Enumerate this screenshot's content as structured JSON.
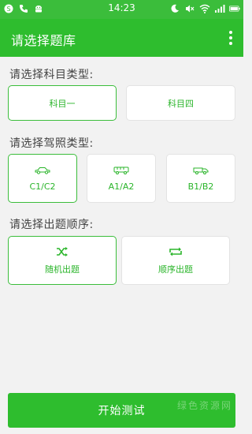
{
  "status_bar": {
    "time": "14:23",
    "left_icons": [
      "s-badge-icon",
      "phone-icon",
      "android-icon"
    ],
    "right_icons": [
      "moon-icon",
      "mute-icon",
      "wifi-icon",
      "signal-icon",
      "battery-icon"
    ]
  },
  "app_bar": {
    "title": "请选择题库",
    "menu_icon": "overflow-menu-icon"
  },
  "subject_section": {
    "label": "请选择科目类型:",
    "options": [
      {
        "label": "科目一",
        "selected": true
      },
      {
        "label": "科目四",
        "selected": false
      }
    ]
  },
  "license_section": {
    "label": "请选择驾照类型:",
    "options": [
      {
        "label": "C1/C2",
        "icon": "car-icon",
        "selected": true
      },
      {
        "label": "A1/A2",
        "icon": "bus-icon",
        "selected": false
      },
      {
        "label": "B1/B2",
        "icon": "truck-icon",
        "selected": false
      }
    ]
  },
  "order_section": {
    "label": "请选择出题顺序:",
    "options": [
      {
        "label": "随机出题",
        "icon": "shuffle-icon",
        "selected": true
      },
      {
        "label": "顺序出题",
        "icon": "repeat-icon",
        "selected": false
      }
    ]
  },
  "start_button": {
    "label": "开始测试"
  },
  "watermark": "绿色资源网",
  "colors": {
    "accent": "#2ebd2e",
    "status_bar": "#3bbd3b",
    "background": "#f2f2f2"
  }
}
